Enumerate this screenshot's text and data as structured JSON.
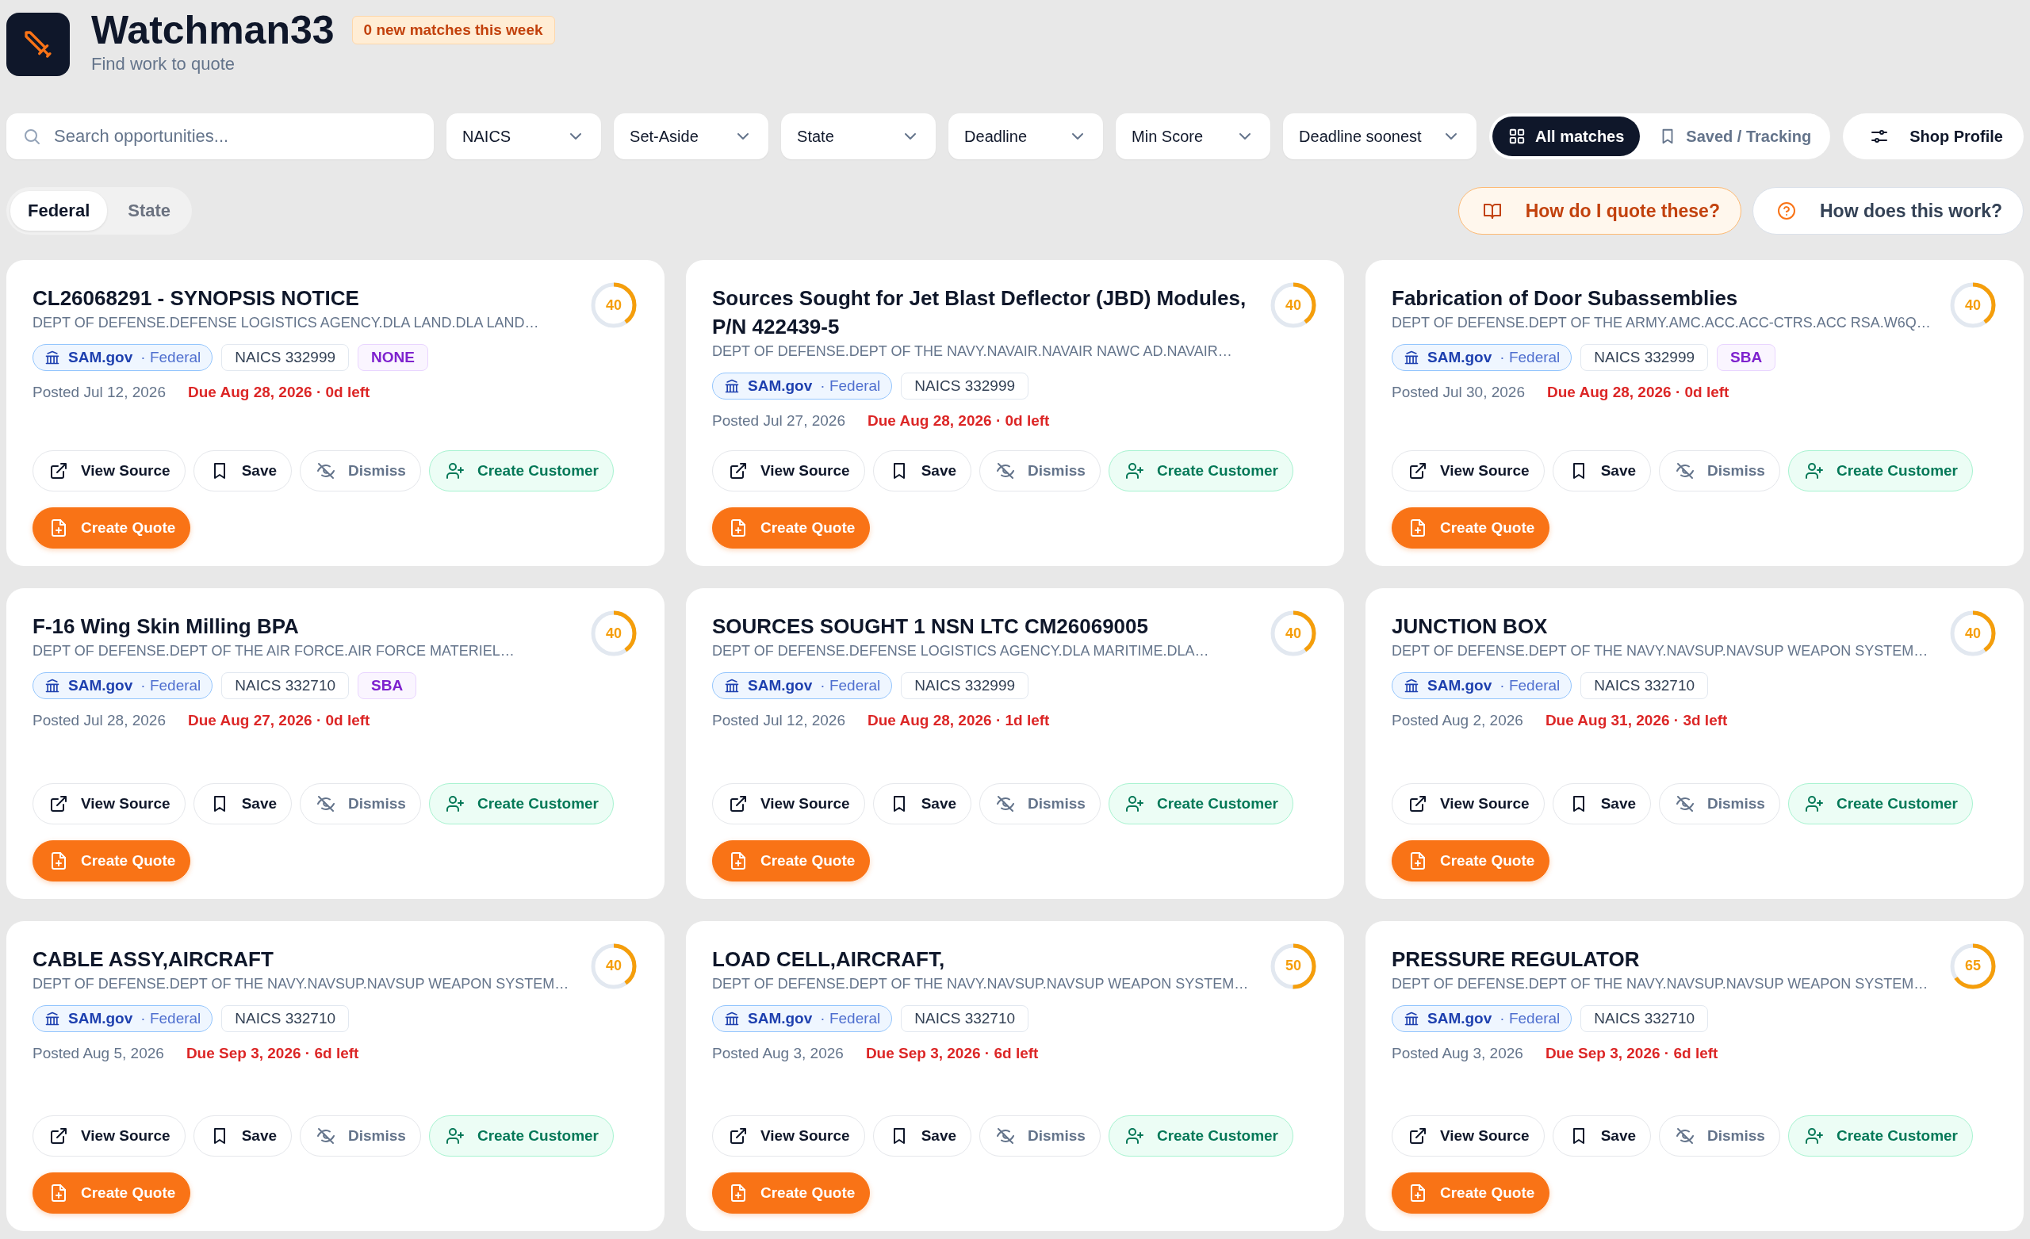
{
  "app": {
    "title": "Watchman33",
    "badge": "0 new matches this week",
    "subtitle": "Find work to quote"
  },
  "search": {
    "placeholder": "Search opportunities..."
  },
  "filters": [
    {
      "label": "NAICS"
    },
    {
      "label": "Set-Aside"
    },
    {
      "label": "State"
    },
    {
      "label": "Deadline"
    },
    {
      "label": "Min Score"
    },
    {
      "label": "Deadline soonest"
    }
  ],
  "view_toggle": [
    {
      "label": "All matches",
      "selected": true,
      "kind": "grid"
    },
    {
      "label": "Saved / Tracking",
      "selected": false,
      "kind": "bookmark"
    }
  ],
  "shop_profile": {
    "label": "Shop Profile"
  },
  "source_tabs": [
    {
      "label": "Federal",
      "selected": true
    },
    {
      "label": "State",
      "selected": false
    }
  ],
  "help_buttons": [
    {
      "label": "How do I quote these?",
      "kind": "guide"
    },
    {
      "label": "How does this work?",
      "kind": "help"
    }
  ],
  "cards": [
    {
      "title": "CL26068291 - SYNOPSIS NOTICE",
      "agency": "DEPT OF DEFENSE.DEFENSE LOGISTICS AGENCY.DLA LAND.DLA LAND…",
      "source": "SAM.gov",
      "source_type": "· Federal",
      "naics": "NAICS 332999",
      "set_aside": "NONE",
      "posted": "Posted Jul 12, 2026",
      "due": "Due Aug 28, 2026 · 0d left",
      "score": "40",
      "level": 0.4,
      "actions": [
        {
          "label": "View Source",
          "kind": "link"
        },
        {
          "label": "Save",
          "kind": "save"
        },
        {
          "label": "Dismiss",
          "kind": "dismiss"
        },
        {
          "label": "Create Customer",
          "kind": "customer"
        },
        {
          "label": "Create Quote",
          "kind": "quote"
        }
      ]
    },
    {
      "title": "Sources Sought for Jet Blast Deflector (JBD) Modules, P/N 422439-5",
      "agency": "DEPT OF DEFENSE.DEPT OF THE NAVY.NAVAIR.NAVAIR NAWC AD.NAVAIR…",
      "source": "SAM.gov",
      "source_type": "· Federal",
      "naics": "NAICS 332999",
      "posted": "Posted Jul 27, 2026",
      "due": "Due Aug 28, 2026 · 0d left",
      "score": "40",
      "level": 0.4,
      "actions": [
        {
          "label": "View Source",
          "kind": "link"
        },
        {
          "label": "Save",
          "kind": "save"
        },
        {
          "label": "Dismiss",
          "kind": "dismiss"
        },
        {
          "label": "Create Customer",
          "kind": "customer"
        },
        {
          "label": "Create Quote",
          "kind": "quote"
        }
      ]
    },
    {
      "title": "Fabrication of Door Subassemblies",
      "agency": "DEPT OF DEFENSE.DEPT OF THE ARMY.AMC.ACC.ACC-CTRS.ACC RSA.W6Q…",
      "source": "SAM.gov",
      "source_type": "· Federal",
      "naics": "NAICS 332999",
      "set_aside": "SBA",
      "posted": "Posted Jul 30, 2026",
      "due": "Due Aug 28, 2026 · 0d left",
      "score": "40",
      "level": 0.4,
      "actions": [
        {
          "label": "View Source",
          "kind": "link"
        },
        {
          "label": "Save",
          "kind": "save"
        },
        {
          "label": "Dismiss",
          "kind": "dismiss"
        },
        {
          "label": "Create Customer",
          "kind": "customer"
        },
        {
          "label": "Create Quote",
          "kind": "quote"
        }
      ]
    },
    {
      "title": "F-16 Wing Skin Milling BPA",
      "agency": "DEPT OF DEFENSE.DEPT OF THE AIR FORCE.AIR FORCE MATERIEL…",
      "source": "SAM.gov",
      "source_type": "· Federal",
      "naics": "NAICS 332710",
      "set_aside": "SBA",
      "posted": "Posted Jul 28, 2026",
      "due": "Due Aug 27, 2026 · 0d left",
      "score": "40",
      "level": 0.4,
      "actions": [
        {
          "label": "View Source",
          "kind": "link"
        },
        {
          "label": "Save",
          "kind": "save"
        },
        {
          "label": "Dismiss",
          "kind": "dismiss"
        },
        {
          "label": "Create Customer",
          "kind": "customer"
        },
        {
          "label": "Create Quote",
          "kind": "quote"
        }
      ]
    },
    {
      "title": "SOURCES SOUGHT 1 NSN LTC CM26069005",
      "agency": "DEPT OF DEFENSE.DEFENSE LOGISTICS AGENCY.DLA MARITIME.DLA…",
      "source": "SAM.gov",
      "source_type": "· Federal",
      "naics": "NAICS 332999",
      "posted": "Posted Jul 12, 2026",
      "due": "Due Aug 28, 2026 · 1d left",
      "score": "40",
      "level": 0.4,
      "actions": [
        {
          "label": "View Source",
          "kind": "link"
        },
        {
          "label": "Save",
          "kind": "save"
        },
        {
          "label": "Dismiss",
          "kind": "dismiss"
        },
        {
          "label": "Create Customer",
          "kind": "customer"
        },
        {
          "label": "Create Quote",
          "kind": "quote"
        }
      ]
    },
    {
      "title": "JUNCTION BOX",
      "agency": "DEPT OF DEFENSE.DEPT OF THE NAVY.NAVSUP.NAVSUP WEAPON SYSTEM…",
      "source": "SAM.gov",
      "source_type": "· Federal",
      "naics": "NAICS 332710",
      "posted": "Posted Aug 2, 2026",
      "due": "Due Aug 31, 2026 · 3d left",
      "score": "40",
      "level": 0.4,
      "actions": [
        {
          "label": "View Source",
          "kind": "link"
        },
        {
          "label": "Save",
          "kind": "save"
        },
        {
          "label": "Dismiss",
          "kind": "dismiss"
        },
        {
          "label": "Create Customer",
          "kind": "customer"
        },
        {
          "label": "Create Quote",
          "kind": "quote"
        }
      ]
    },
    {
      "title": "CABLE ASSY,AIRCRAFT",
      "agency": "DEPT OF DEFENSE.DEPT OF THE NAVY.NAVSUP.NAVSUP WEAPON SYSTEM…",
      "source": "SAM.gov",
      "source_type": "· Federal",
      "naics": "NAICS 332710",
      "posted": "Posted Aug 5, 2026",
      "due": "Due Sep 3, 2026 · 6d left",
      "score": "40",
      "level": 0.4,
      "actions": [
        {
          "label": "View Source",
          "kind": "link"
        },
        {
          "label": "Save",
          "kind": "save"
        },
        {
          "label": "Dismiss",
          "kind": "dismiss"
        },
        {
          "label": "Create Customer",
          "kind": "customer"
        },
        {
          "label": "Create Quote",
          "kind": "quote"
        }
      ]
    },
    {
      "title": "LOAD CELL,AIRCRAFT,",
      "agency": "DEPT OF DEFENSE.DEPT OF THE NAVY.NAVSUP.NAVSUP WEAPON SYSTEM…",
      "source": "SAM.gov",
      "source_type": "· Federal",
      "naics": "NAICS 332710",
      "posted": "Posted Aug 3, 2026",
      "due": "Due Sep 3, 2026 · 6d left",
      "score": "50",
      "level": 0.5,
      "actions": [
        {
          "label": "View Source",
          "kind": "link"
        },
        {
          "label": "Save",
          "kind": "save"
        },
        {
          "label": "Dismiss",
          "kind": "dismiss"
        },
        {
          "label": "Create Customer",
          "kind": "customer"
        },
        {
          "label": "Create Quote",
          "kind": "quote"
        }
      ]
    },
    {
      "title": "PRESSURE REGULATOR",
      "agency": "DEPT OF DEFENSE.DEPT OF THE NAVY.NAVSUP.NAVSUP WEAPON SYSTEM…",
      "source": "SAM.gov",
      "source_type": "· Federal",
      "naics": "NAICS 332710",
      "posted": "Posted Aug 3, 2026",
      "due": "Due Sep 3, 2026 · 6d left",
      "score": "65",
      "level": 0.65,
      "actions": [
        {
          "label": "View Source",
          "kind": "link"
        },
        {
          "label": "Save",
          "kind": "save"
        },
        {
          "label": "Dismiss",
          "kind": "dismiss"
        },
        {
          "label": "Create Customer",
          "kind": "customer"
        },
        {
          "label": "Create Quote",
          "kind": "quote"
        }
      ]
    }
  ]
}
